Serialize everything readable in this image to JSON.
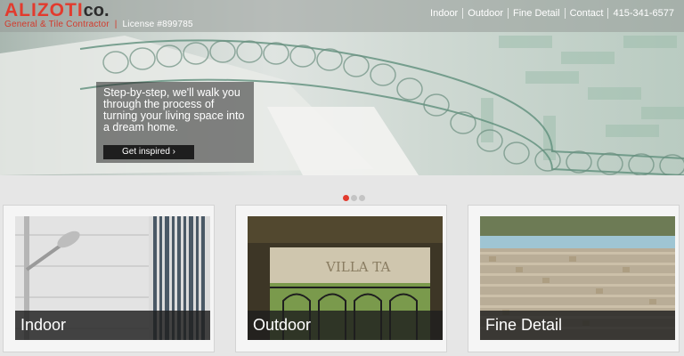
{
  "header": {
    "brand": "ALIZOTI",
    "brand_suffix": "co.",
    "tagline": "General & Tile Contractor",
    "license": "License #899785"
  },
  "nav": {
    "items": [
      "Indoor",
      "Outdoor",
      "Fine Detail",
      "Contact",
      "415-341-6577"
    ]
  },
  "hero": {
    "text": "Step-by-step, we'll walk you through the process of turning your living space into a dream home.",
    "cta_label": "Get inspired ›"
  },
  "slider": {
    "slide_count": 3,
    "active_slide": 1
  },
  "cards": [
    {
      "label": "Indoor"
    },
    {
      "label": "Outdoor"
    },
    {
      "label": "Fine Detail"
    }
  ],
  "colors": {
    "accent": "#e23b2e",
    "overlay": "#1e1e1e"
  }
}
